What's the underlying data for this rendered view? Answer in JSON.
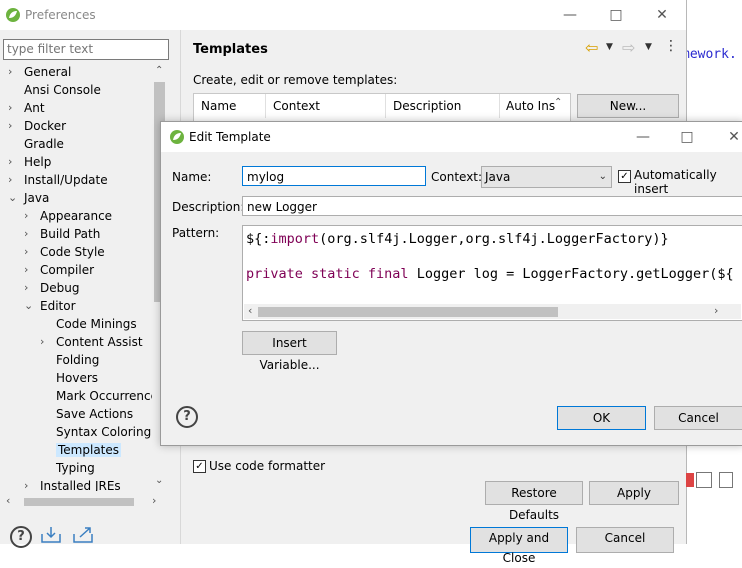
{
  "background": {
    "code_fragment": "mework."
  },
  "preferences": {
    "title": "Preferences",
    "filter_placeholder": "type filter text",
    "tree": [
      {
        "label": "General",
        "level": 0,
        "expand": "closed"
      },
      {
        "label": "Ansi Console",
        "level": 0,
        "expand": "none"
      },
      {
        "label": "Ant",
        "level": 0,
        "expand": "closed"
      },
      {
        "label": "Docker",
        "level": 0,
        "expand": "closed"
      },
      {
        "label": "Gradle",
        "level": 0,
        "expand": "none"
      },
      {
        "label": "Help",
        "level": 0,
        "expand": "closed"
      },
      {
        "label": "Install/Update",
        "level": 0,
        "expand": "closed"
      },
      {
        "label": "Java",
        "level": 0,
        "expand": "open"
      },
      {
        "label": "Appearance",
        "level": 1,
        "expand": "closed"
      },
      {
        "label": "Build Path",
        "level": 1,
        "expand": "closed"
      },
      {
        "label": "Code Style",
        "level": 1,
        "expand": "closed"
      },
      {
        "label": "Compiler",
        "level": 1,
        "expand": "closed"
      },
      {
        "label": "Debug",
        "level": 1,
        "expand": "closed"
      },
      {
        "label": "Editor",
        "level": 1,
        "expand": "open"
      },
      {
        "label": "Code Minings",
        "level": 2,
        "expand": "none"
      },
      {
        "label": "Content Assist",
        "level": 2,
        "expand": "closed"
      },
      {
        "label": "Folding",
        "level": 2,
        "expand": "none"
      },
      {
        "label": "Hovers",
        "level": 2,
        "expand": "none"
      },
      {
        "label": "Mark Occurrences",
        "level": 2,
        "expand": "none"
      },
      {
        "label": "Save Actions",
        "level": 2,
        "expand": "none"
      },
      {
        "label": "Syntax Coloring",
        "level": 2,
        "expand": "none"
      },
      {
        "label": "Templates",
        "level": 2,
        "expand": "none",
        "selected": true
      },
      {
        "label": "Typing",
        "level": 2,
        "expand": "none"
      },
      {
        "label": "Installed JREs",
        "level": 1,
        "expand": "closed"
      }
    ],
    "page_title": "Templates",
    "description": "Create, edit or remove templates:",
    "columns": [
      "Name",
      "Context",
      "Description",
      "Auto Ins"
    ],
    "new_button": "New...",
    "use_code_formatter": "Use code formatter",
    "restore_defaults": "Restore Defaults",
    "apply": "Apply",
    "apply_and_close": "Apply and Close",
    "cancel": "Cancel"
  },
  "dialog": {
    "title": "Edit Template",
    "name_label": "Name:",
    "name_value": "mylog",
    "context_label": "Context:",
    "context_value": "Java",
    "auto_insert_label": "Automatically insert",
    "description_label": "Description:",
    "description_value": "new Logger",
    "pattern_label": "Pattern:",
    "pattern_line1_prefix": "${:",
    "pattern_line1_kw": "import",
    "pattern_line1_rest": "(org.slf4j.Logger,org.slf4j.LoggerFactory)}",
    "pattern_line2_kw": "private static final",
    "pattern_line2_rest": " Logger log = LoggerFactory.getLogger(${",
    "insert_variable": "Insert Variable...",
    "ok": "OK",
    "cancel": "Cancel"
  }
}
